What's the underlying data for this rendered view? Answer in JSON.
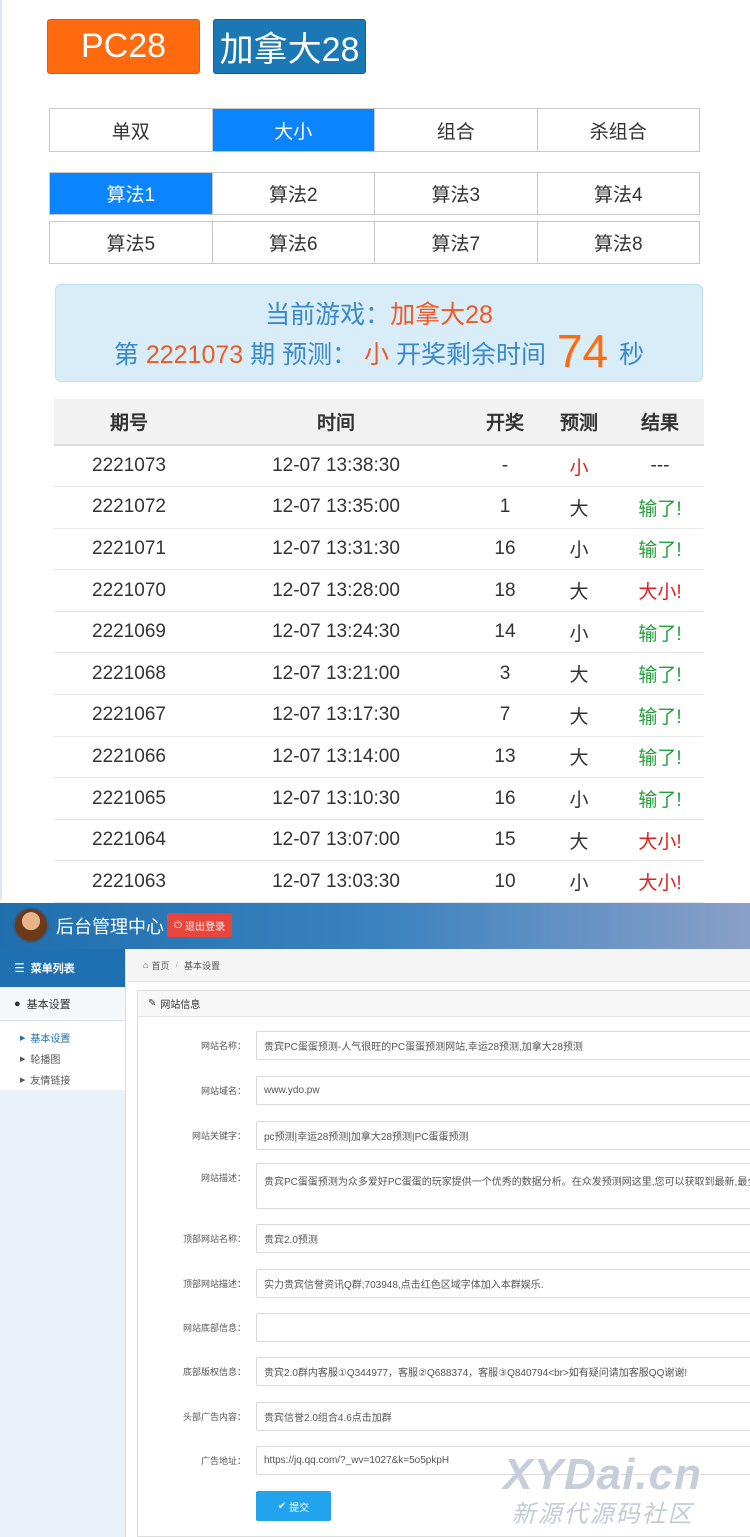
{
  "games": {
    "pc28": "PC28",
    "canada28": "加拿大28"
  },
  "type_tabs": [
    "单双",
    "大小",
    "组合",
    "杀组合"
  ],
  "algo_tabs_row1": [
    "算法1",
    "算法2",
    "算法3",
    "算法4"
  ],
  "algo_tabs_row2": [
    "算法5",
    "算法6",
    "算法7",
    "算法8"
  ],
  "info": {
    "current_label": "当前游戏：",
    "current_game": "加拿大28",
    "period_prefix": "第",
    "period": "2221073",
    "period_suffix": "期 预测：",
    "prediction": "小",
    "remaining_label": "开奖剩余时间",
    "seconds": "74",
    "seconds_unit": "秒"
  },
  "table": {
    "headers": [
      "期号",
      "时间",
      "开奖",
      "预测",
      "结果"
    ],
    "rows": [
      [
        "2221073",
        "12-07 13:38:30",
        "-",
        "小",
        "---"
      ],
      [
        "2221072",
        "12-07 13:35:00",
        "1",
        "大",
        "输了!"
      ],
      [
        "2221071",
        "12-07 13:31:30",
        "16",
        "小",
        "输了!"
      ],
      [
        "2221070",
        "12-07 13:28:00",
        "18",
        "大",
        "大小!"
      ],
      [
        "2221069",
        "12-07 13:24:30",
        "14",
        "小",
        "输了!"
      ],
      [
        "2221068",
        "12-07 13:21:00",
        "3",
        "大",
        "输了!"
      ],
      [
        "2221067",
        "12-07 13:17:30",
        "7",
        "大",
        "输了!"
      ],
      [
        "2221066",
        "12-07 13:14:00",
        "13",
        "大",
        "输了!"
      ],
      [
        "2221065",
        "12-07 13:10:30",
        "16",
        "小",
        "输了!"
      ],
      [
        "2221064",
        "12-07 13:07:00",
        "15",
        "大",
        "大小!"
      ],
      [
        "2221063",
        "12-07 13:03:30",
        "10",
        "小",
        "大小!"
      ]
    ]
  },
  "admin": {
    "title": "后台管理中心",
    "logout": "退出登录",
    "menu_list": "菜单列表",
    "menu_group": "基本设置",
    "sub_items": [
      "基本设置",
      "轮播图",
      "友情链接"
    ],
    "breadcrumb": {
      "home": "首页",
      "current": "基本设置"
    },
    "panel_title": "网站信息",
    "fields": [
      {
        "label": "网站名称：",
        "value": "贵宾PC蛋蛋预测-人气很旺的PC蛋蛋预测网站,幸运28预测,加拿大28预测"
      },
      {
        "label": "网站域名：",
        "value": "www.ydo.pw"
      },
      {
        "label": "网站关键字：",
        "value": "pc预测|幸运28预测|加拿大28预测|PC蛋蛋预测"
      },
      {
        "label": "网站描述：",
        "value": "贵宾PC蛋蛋预测为众多爱好PC蛋蛋的玩家提供一个优秀的数据分析。在众发预测网这里,您可以获取到最新,最全的"
      },
      {
        "label": "顶部网站名称：",
        "value": "贵宾2.0预测"
      },
      {
        "label": "顶部网站描述：",
        "value": "实力贵宾信誉资讯Q群;703948,点击红色区域字体加入本群娱乐."
      },
      {
        "label": "网站底部信息：",
        "value": ""
      },
      {
        "label": "底部版权信息：",
        "value": "贵宾2.0群内客服①Q344977，客服②Q688374，客服③Q840794<br>如有疑问请加客服QQ谢谢!"
      },
      {
        "label": "头部广告内容：",
        "value": "贵宾信誉2.0组合4.6点击加群"
      },
      {
        "label": "广告地址：",
        "value": "https://jq.qq.com/?_wv=1027&k=5o5pkpH"
      }
    ],
    "submit": "提交"
  },
  "watermark": {
    "main": "XYDai.cn",
    "sub": "新源代源码社区"
  },
  "colors": {
    "pc28": "#ff6a0e",
    "canada28": "#1a78b4",
    "active_tab": "#0a84ff",
    "win_red": "#e02020",
    "lose_green": "#23a03c",
    "info_bg": "#d8edf7",
    "admin_header": "#1f6fae",
    "logout": "#e8453c",
    "submit": "#22a3ee"
  },
  "icons": [
    "power-icon",
    "list-icon",
    "user-icon",
    "home-icon",
    "edit-icon",
    "triangle-right-icon",
    "check-icon"
  ]
}
